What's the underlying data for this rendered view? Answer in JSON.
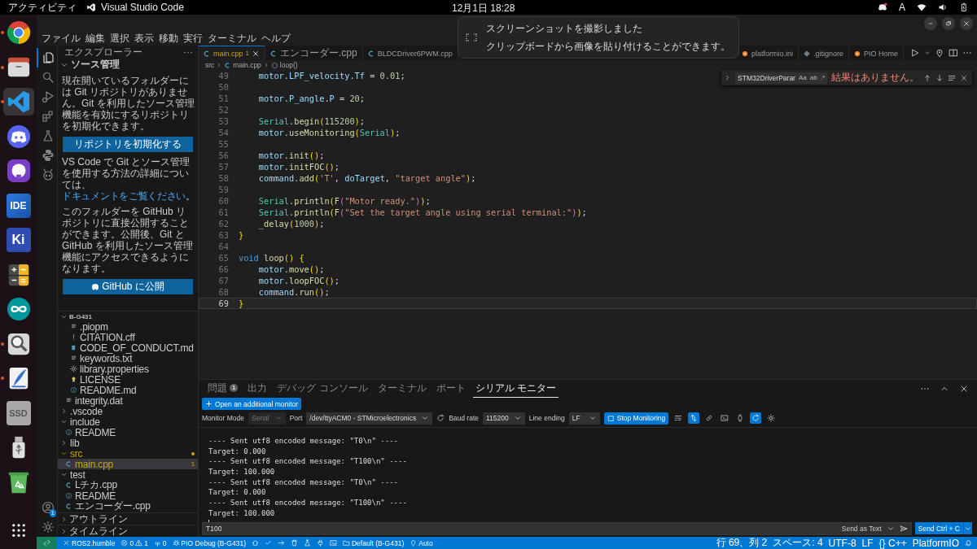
{
  "top_bar": {
    "activities": "アクティビティ",
    "app": "Visual Studio Code",
    "clock": "12月1日  18:28",
    "keyboard": "A"
  },
  "dock": [
    {
      "kind": "chrome",
      "running": true,
      "selected": false
    },
    {
      "kind": "files",
      "running": true,
      "selected": false
    },
    {
      "kind": "vscode",
      "running": true,
      "selected": true
    },
    {
      "kind": "discord",
      "running": false,
      "selected": false
    },
    {
      "kind": "github",
      "running": false,
      "selected": false
    },
    {
      "kind": "ide",
      "label": "IDE",
      "running": false,
      "selected": false
    },
    {
      "kind": "kicad",
      "label": "Ki",
      "running": false,
      "selected": false
    },
    {
      "kind": "calc",
      "running": false,
      "selected": false
    },
    {
      "kind": "arduino",
      "running": false,
      "selected": false
    },
    {
      "kind": "magnifier",
      "running": true,
      "selected": false
    },
    {
      "kind": "writer",
      "running": true,
      "selected": false
    },
    {
      "kind": "ssd",
      "label": "SSD",
      "running": false,
      "selected": false
    },
    {
      "kind": "usb",
      "running": false,
      "selected": false
    },
    {
      "kind": "trash",
      "running": false,
      "selected": false
    }
  ],
  "notification": {
    "title": "スクリーンショットを撮影しました",
    "body": "クリップボードから画像を貼り付けることができます。"
  },
  "menu": [
    "ファイル",
    "編集",
    "選択",
    "表示",
    "移動",
    "実行",
    "ターミナル",
    "ヘルプ"
  ],
  "activity_bar": [
    {
      "kind": "files",
      "selected": true
    },
    {
      "kind": "search",
      "selected": false
    },
    {
      "kind": "debug",
      "selected": false
    },
    {
      "kind": "extensions",
      "selected": false
    },
    {
      "kind": "flask",
      "selected": false
    },
    {
      "kind": "python",
      "selected": false
    },
    {
      "kind": "alien",
      "selected": false
    }
  ],
  "accounts_badge": "1",
  "sidebar": {
    "title": "エクスプローラー",
    "more": "···",
    "source_control": {
      "title": "ソース管理",
      "expanded": true,
      "text1": "現在開いているフォルダーには Git リポジトリがありません。Git を利用したソース管理機能を有効にするリポジトリを初期化できます。",
      "init_button": "リポジトリを初期化する",
      "text2": "VS Code で Git とソース管理を使用する方法の詳細については、",
      "link": "ドキュメントをご覧ください",
      "text2_end": "。",
      "text3": "このフォルダーを GitHub リポジトリに直接公開することができます。公開後、Git と GitHub を利用したソース管理機能にアクセスできるようになります。",
      "publish_button": "GitHub に公開"
    },
    "project": {
      "title": "B-G431",
      "expanded": true,
      "tree": [
        {
          "children": [
            {
              "children": [
                {
                  "label": ".piopm",
                  "kind": "text",
                  "selected": false,
                  "warning": false
                },
                {
                  "label": "CITATION.cff",
                  "kind": "bang",
                  "selected": false,
                  "warning": false
                },
                {
                  "label": "CODE_OF_CONDUCT.md",
                  "kind": "md",
                  "selected": false,
                  "warning": false
                },
                {
                  "label": "keywords.txt",
                  "kind": "text",
                  "selected": false,
                  "warning": false
                },
                {
                  "label": "library.properties",
                  "kind": "gear",
                  "selected": false,
                  "warning": false
                },
                {
                  "label": "LICENSE",
                  "kind": "license",
                  "selected": false,
                  "warning": false
                },
                {
                  "label": "README.md",
                  "kind": "info",
                  "selected": false,
                  "warning": false
                }
              ]
            },
            {
              "label": "integrity.dat",
              "kind": "text",
              "selected": false,
              "warning": false
            }
          ]
        },
        {
          "label": ".vscode",
          "kind": "folder",
          "expanded": false,
          "selected": false,
          "warning": false
        },
        {
          "label": "include",
          "kind": "folder",
          "expanded": true,
          "selected": false,
          "warning": false,
          "children": [
            {
              "label": "README",
              "kind": "info",
              "selected": false,
              "warning": false
            }
          ]
        },
        {
          "label": "lib",
          "kind": "folder",
          "expanded": false,
          "selected": false,
          "warning": false
        },
        {
          "label": "src",
          "kind": "folder",
          "expanded": true,
          "selected": false,
          "warning": true,
          "children": [
            {
              "label": "main.cpp",
              "kind": "cpp",
              "selected": true,
              "warning": true,
              "badge": "1"
            }
          ]
        },
        {
          "label": "test",
          "kind": "folder",
          "expanded": true,
          "selected": false,
          "warning": false,
          "children": [
            {
              "label": "Lチカ.cpp",
              "kind": "cpp",
              "selected": false,
              "warning": false
            },
            {
              "label": "README",
              "kind": "info",
              "selected": false,
              "warning": false
            },
            {
              "label": "エンコーダー.cpp",
              "kind": "cpp",
              "selected": false,
              "warning": false
            }
          ]
        }
      ]
    },
    "sections": [
      {
        "title": "アウトライン",
        "expanded": false
      },
      {
        "title": "タイムライン",
        "expanded": false
      }
    ]
  },
  "editor": {
    "tabs": [
      {
        "label": "main.cpp",
        "kind": "cpp",
        "selected": true,
        "warning": true,
        "badge": "1"
      },
      {
        "label": "エンコーダー.cpp",
        "kind": "cpp",
        "selected": false,
        "warning": false
      },
      {
        "label": "BLDCDriver6PWM.cpp",
        "kind": "cpp",
        "selected": false,
        "warning": false
      },
      {
        "label": "platformio.ini",
        "kind": "pio",
        "selected": false,
        "warning": false
      },
      {
        "label": ".gitignore",
        "kind": "git",
        "selected": false,
        "warning": false
      },
      {
        "label": "PIO Home",
        "kind": "pio",
        "selected": false,
        "warning": false
      }
    ],
    "breadcrumb": [
      "src",
      "main.cpp",
      "loop()"
    ],
    "find": {
      "value": "STM32DriverParar",
      "options": [
        "Aa",
        "ab",
        ".*"
      ],
      "result": "結果はありません。"
    },
    "lines": [
      {
        "n": "49",
        "indented": true,
        "current": false,
        "tokens": [
          {
            "text": "motor",
            "kind": "var"
          },
          {
            "text": ".",
            "kind": "punct"
          },
          {
            "text": "LPF_velocity",
            "kind": "var"
          },
          {
            "text": ".",
            "kind": "punct"
          },
          {
            "text": "Tf",
            "kind": "var"
          },
          {
            "text": " =",
            "kind": "punct"
          },
          {
            "text": " 0.01",
            "kind": "num"
          },
          {
            "text": ";",
            "kind": "punct"
          }
        ]
      },
      {
        "n": "50"
      },
      {
        "n": "51",
        "indented": true,
        "current": false,
        "tokens": [
          {
            "text": "motor",
            "kind": "var"
          },
          {
            "text": ".",
            "kind": "punct"
          },
          {
            "text": "P_angle",
            "kind": "var"
          },
          {
            "text": ".",
            "kind": "punct"
          },
          {
            "text": "P",
            "kind": "var"
          },
          {
            "text": " =",
            "kind": "punct"
          },
          {
            "text": " 20",
            "kind": "num"
          },
          {
            "text": ";",
            "kind": "punct"
          }
        ]
      },
      {
        "n": "52"
      },
      {
        "n": "53",
        "indented": true,
        "current": false,
        "tokens": [
          {
            "text": "Serial",
            "kind": "type"
          },
          {
            "text": ".",
            "kind": "punct"
          },
          {
            "text": "begin",
            "kind": "fn"
          },
          {
            "text": "(",
            "kind": "paren"
          },
          {
            "text": "115200",
            "kind": "num"
          },
          {
            "text": ")",
            "kind": "paren"
          },
          {
            "text": ";",
            "kind": "punct"
          }
        ]
      },
      {
        "n": "54",
        "indented": true,
        "current": false,
        "tokens": [
          {
            "text": "motor",
            "kind": "var"
          },
          {
            "text": ".",
            "kind": "punct"
          },
          {
            "text": "useMonitoring",
            "kind": "fn"
          },
          {
            "text": "(",
            "kind": "paren"
          },
          {
            "text": "Serial",
            "kind": "type"
          },
          {
            "text": ")",
            "kind": "paren"
          },
          {
            "text": ";",
            "kind": "punct"
          }
        ]
      },
      {
        "n": "55"
      },
      {
        "n": "56",
        "indented": true,
        "current": false,
        "tokens": [
          {
            "text": "motor",
            "kind": "var"
          },
          {
            "text": ".",
            "kind": "punct"
          },
          {
            "text": "init",
            "kind": "fn"
          },
          {
            "text": "()",
            "kind": "paren"
          },
          {
            "text": ";",
            "kind": "punct"
          }
        ]
      },
      {
        "n": "57",
        "indented": true,
        "current": false,
        "tokens": [
          {
            "text": "motor",
            "kind": "var"
          },
          {
            "text": ".",
            "kind": "punct"
          },
          {
            "text": "initFOC",
            "kind": "fn"
          },
          {
            "text": "()",
            "kind": "paren"
          },
          {
            "text": ";",
            "kind": "punct"
          }
        ]
      },
      {
        "n": "58",
        "indented": true,
        "current": false,
        "tokens": [
          {
            "text": "command",
            "kind": "var"
          },
          {
            "text": ".",
            "kind": "punct"
          },
          {
            "text": "add",
            "kind": "fn"
          },
          {
            "text": "(",
            "kind": "paren"
          },
          {
            "text": "'T'",
            "kind": "str"
          },
          {
            "text": ",",
            "kind": "punct"
          },
          {
            "text": " doTarget",
            "kind": "var"
          },
          {
            "text": ",",
            "kind": "punct"
          },
          {
            "text": " \"target angle\"",
            "kind": "str"
          },
          {
            "text": ")",
            "kind": "paren"
          },
          {
            "text": ";",
            "kind": "punct"
          }
        ]
      },
      {
        "n": "59"
      },
      {
        "n": "60",
        "indented": true,
        "current": false,
        "tokens": [
          {
            "text": "Serial",
            "kind": "type"
          },
          {
            "text": ".",
            "kind": "punct"
          },
          {
            "text": "println",
            "kind": "fn"
          },
          {
            "text": "(",
            "kind": "paren"
          },
          {
            "text": "F",
            "kind": "fn"
          },
          {
            "text": "(",
            "kind": "paren2"
          },
          {
            "text": "\"Motor ready.\"",
            "kind": "str"
          },
          {
            "text": ")",
            "kind": "paren2"
          },
          {
            "text": ")",
            "kind": "paren"
          },
          {
            "text": ";",
            "kind": "punct"
          }
        ]
      },
      {
        "n": "61",
        "indented": true,
        "current": false,
        "tokens": [
          {
            "text": "Serial",
            "kind": "type"
          },
          {
            "text": ".",
            "kind": "punct"
          },
          {
            "text": "println",
            "kind": "fn"
          },
          {
            "text": "(",
            "kind": "paren"
          },
          {
            "text": "F",
            "kind": "fn"
          },
          {
            "text": "(",
            "kind": "paren2"
          },
          {
            "text": "\"Set the target angle using serial terminal:\"",
            "kind": "str"
          },
          {
            "text": ")",
            "kind": "paren2"
          },
          {
            "text": ")",
            "kind": "paren"
          },
          {
            "text": ";",
            "kind": "punct"
          }
        ]
      },
      {
        "n": "62",
        "indented": true,
        "current": false,
        "tokens": [
          {
            "text": "_delay",
            "kind": "fn"
          },
          {
            "text": "(",
            "kind": "paren"
          },
          {
            "text": "1000",
            "kind": "num"
          },
          {
            "text": ")",
            "kind": "paren"
          },
          {
            "text": ";",
            "kind": "punct"
          }
        ]
      },
      {
        "n": "63",
        "indented": false,
        "current": false,
        "tokens": [
          {
            "text": "}",
            "kind": "paren"
          }
        ]
      },
      {
        "n": "64"
      },
      {
        "n": "65",
        "indented": false,
        "current": false,
        "tokens": [
          {
            "text": "void",
            "kind": "kw"
          },
          {
            "text": " loop",
            "kind": "fn"
          },
          {
            "text": "()",
            "kind": "paren"
          },
          {
            "text": " {",
            "kind": "paren"
          }
        ]
      },
      {
        "n": "66",
        "indented": true,
        "current": false,
        "tokens": [
          {
            "text": "motor",
            "kind": "var"
          },
          {
            "text": ".",
            "kind": "punct"
          },
          {
            "text": "move",
            "kind": "fn"
          },
          {
            "text": "()",
            "kind": "paren"
          },
          {
            "text": ";",
            "kind": "punct"
          }
        ]
      },
      {
        "n": "67",
        "indented": true,
        "current": false,
        "tokens": [
          {
            "text": "motor",
            "kind": "var"
          },
          {
            "text": ".",
            "kind": "punct"
          },
          {
            "text": "loopFOC",
            "kind": "fn"
          },
          {
            "text": "()",
            "kind": "paren"
          },
          {
            "text": ";",
            "kind": "punct"
          }
        ]
      },
      {
        "n": "68",
        "indented": true,
        "current": false,
        "tokens": [
          {
            "text": "command",
            "kind": "var"
          },
          {
            "text": ".",
            "kind": "punct"
          },
          {
            "text": "run",
            "kind": "fn"
          },
          {
            "text": "()",
            "kind": "paren"
          },
          {
            "text": ";",
            "kind": "punct"
          }
        ]
      },
      {
        "n": "69",
        "indented": false,
        "current": true,
        "tokens": [
          {
            "text": "}",
            "kind": "paren"
          }
        ]
      }
    ]
  },
  "panel": {
    "tabs": [
      {
        "label": "問題",
        "badge": "1",
        "selected": false
      },
      {
        "label": "出力",
        "selected": false
      },
      {
        "label": "デバッグ コンソール",
        "selected": false
      },
      {
        "label": "ターミナル",
        "selected": false
      },
      {
        "label": "ポート",
        "selected": false
      },
      {
        "label": "シリアル モニター",
        "selected": true
      }
    ],
    "monitor": {
      "open_button": "Open an additional monitor",
      "mode_label": "Monitor Mode",
      "mode": "Serial",
      "mode_disabled": true,
      "port_label": "Port",
      "port": "/dev/ttyACM0 - STMicroelectronics",
      "baud_label": "Baud rate",
      "baud": "115200",
      "ending_label": "Line ending",
      "ending": "LF",
      "stop_button": "Stop Monitoring",
      "toggles": [
        {
          "kind": "wrap",
          "on": false
        },
        {
          "kind": "autoscroll",
          "on": true
        },
        {
          "kind": "link",
          "on": false
        },
        {
          "kind": "terminal",
          "on": false
        },
        {
          "kind": "watch",
          "on": false
        },
        {
          "kind": "reconnect",
          "on": true
        },
        {
          "kind": "settings",
          "on": false
        }
      ]
    },
    "output": [
      "---- Sent utf8 encoded message: \"T0\\n\" ----",
      "Target: 0.000",
      "---- Sent utf8 encoded message: \"T100\\n\" ----",
      "Target: 100.000",
      "---- Sent utf8 encoded message: \"T0\\n\" ----",
      "Target: 0.000",
      "---- Sent utf8 encoded message: \"T100\\n\" ----",
      "Target: 100.000"
    ],
    "input": {
      "value": "T100",
      "mode": "Send as Text",
      "send_button": "Send Ctrl + C"
    }
  },
  "status_bar": {
    "left": [
      {
        "kind": "close",
        "text": "ROS2.humble"
      },
      {
        "kind": "problems",
        "errors": "0",
        "warnings": "1"
      },
      {
        "kind": "radio",
        "text": "0"
      },
      {
        "kind": "bug",
        "text": "PIO Debug (B-G431)"
      },
      {
        "kind": "home"
      },
      {
        "kind": "check"
      },
      {
        "kind": "arrow"
      },
      {
        "kind": "trash"
      },
      {
        "kind": "flask"
      },
      {
        "kind": "plug"
      },
      {
        "kind": "terminal"
      },
      {
        "kind": "folder",
        "text": "Default (B-G431)"
      },
      {
        "kind": "pin",
        "text": "Auto"
      }
    ],
    "right": [
      "行 69、列 2",
      "スペース: 4",
      "UTF-8",
      "LF",
      "{} C++",
      "PlatformIO"
    ]
  }
}
